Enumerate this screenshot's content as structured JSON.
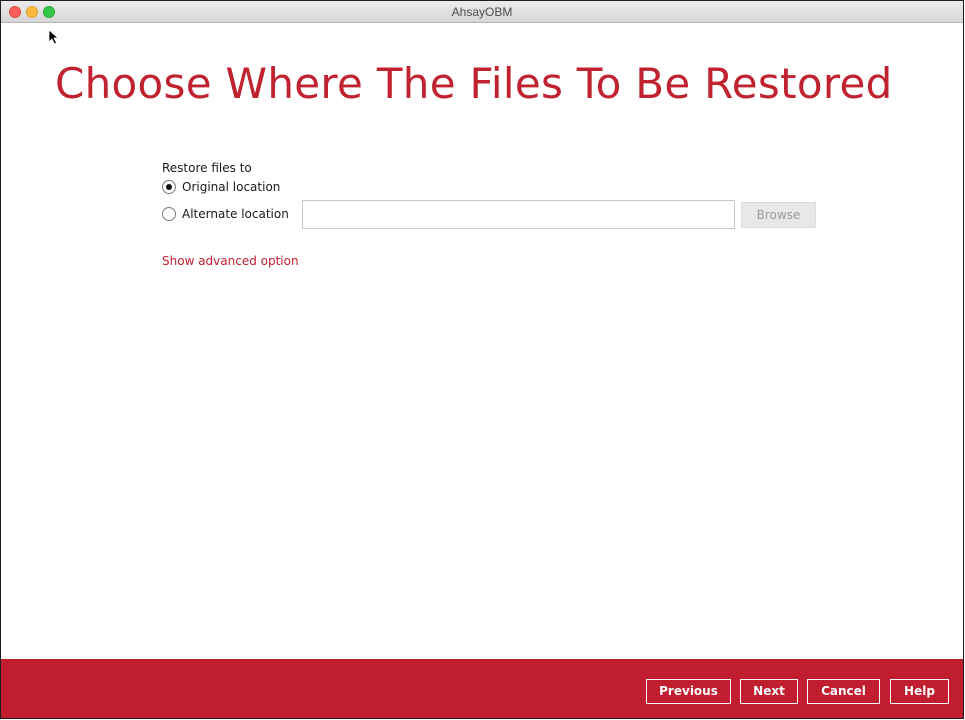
{
  "window": {
    "title": "AhsayOBM"
  },
  "page": {
    "title": "Choose Where The Files To Be Restored"
  },
  "restore": {
    "label": "Restore files to",
    "original_label": "Original location",
    "original_selected": true,
    "alternate_label": "Alternate location",
    "alternate_selected": false,
    "alternate_path_value": "",
    "browse_label": "Browse",
    "browse_enabled": false
  },
  "advanced": {
    "link_label": "Show advanced option"
  },
  "footer": {
    "previous_label": "Previous",
    "next_label": "Next",
    "cancel_label": "Cancel",
    "help_label": "Help"
  },
  "colors": {
    "accent": "#c01d2e",
    "title_red": "#c0222f",
    "traffic_close": "#fc605c",
    "traffic_minimize": "#fdbc40",
    "traffic_zoom": "#34c84a"
  },
  "icons": {
    "cursor": "mouse-pointer-icon"
  }
}
